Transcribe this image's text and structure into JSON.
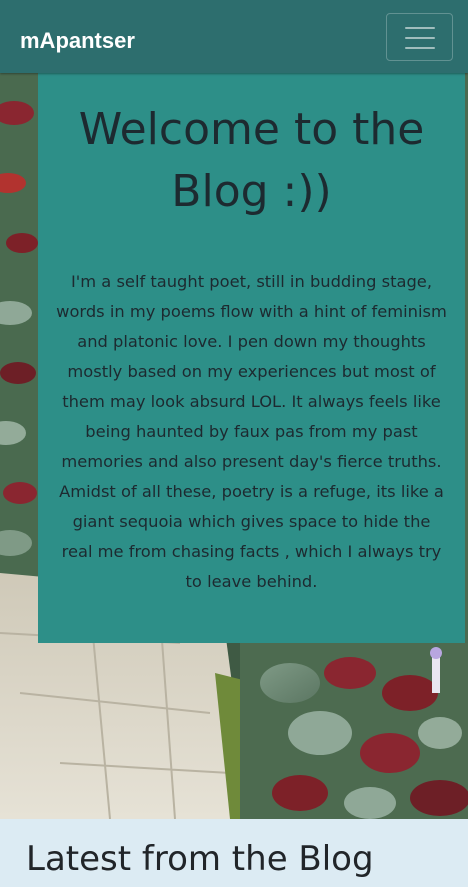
{
  "navbar": {
    "brand": "mApantser",
    "toggler_icon": "hamburger-menu-icon"
  },
  "hero": {
    "title": "Welcome to the Blog :))",
    "body": "I'm a self taught poet, still in budding stage, words in my poems flow with a hint of feminism and platonic love. I pen down my thoughts mostly based on my experiences but most of them may look absurd LOL. It always feels like being haunted by faux pas from my past memories and also present day's fierce truths. Amidst of all these, poetry is a refuge, its like a giant sequoia which gives space to hide the real me from chasing facts , which I always try to leave behind.",
    "background_image": "garden-path-with-plants"
  },
  "latest": {
    "heading": "Latest from the Blog"
  },
  "colors": {
    "navbar": "#2d6e6e",
    "card": "#2d8f88",
    "section": "#dcebf3",
    "text": "#1d2a30"
  }
}
